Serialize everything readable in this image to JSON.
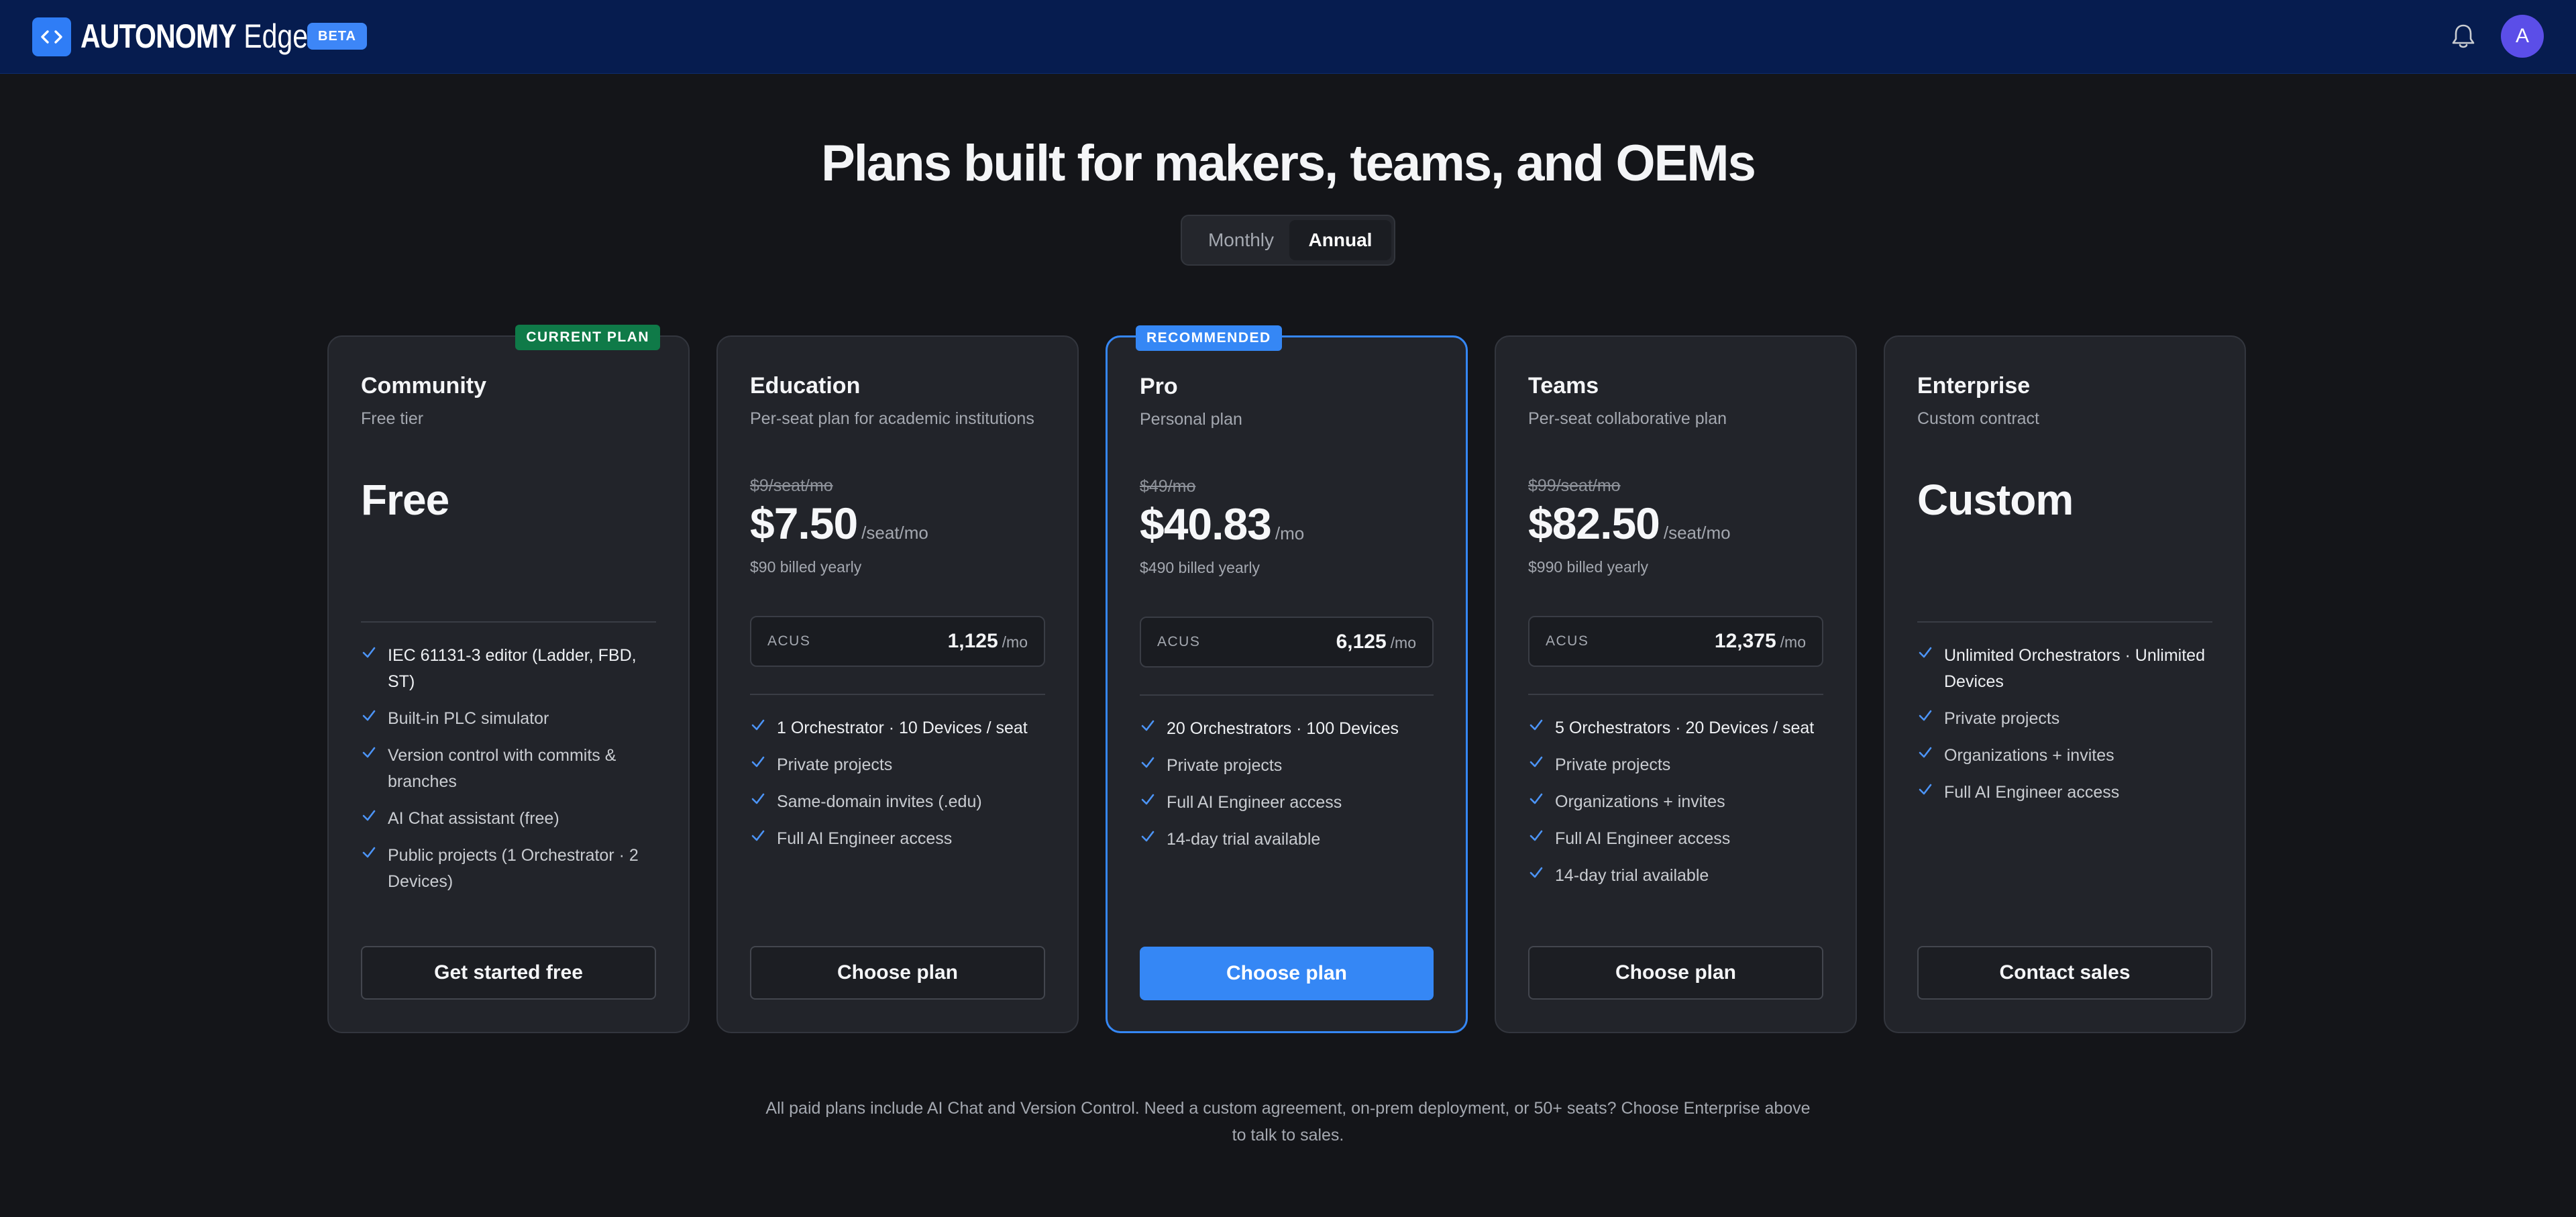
{
  "app": {
    "brand_bold": "AUTONOMY",
    "brand_light": "Edge",
    "beta_badge": "BETA",
    "avatar_initial": "A",
    "icons": [
      "code-brackets-icon",
      "bell-icon"
    ],
    "accent_color": "#3587f5"
  },
  "page": {
    "title": "Plans built for makers, teams, and OEMs",
    "billing_toggle": {
      "monthly": "Monthly",
      "annual": "Annual",
      "selected": "Annual"
    }
  },
  "plans": [
    {
      "name": "Community",
      "subtitle": "Free tier",
      "badge": "CURRENT PLAN",
      "price": "Free",
      "features": [
        "IEC 61131-3 editor (Ladder, FBD, ST)",
        "Built-in PLC simulator",
        "Version control with commits & branches",
        "AI Chat assistant (free)",
        "Public projects (1 Orchestrator · 2 Devices)"
      ],
      "cta": "Get started free"
    },
    {
      "name": "Education",
      "subtitle": "Per-seat plan for academic institutions",
      "old_price": "$9/seat/mo",
      "price": "$7.50",
      "price_unit": "/seat/mo",
      "billed": "$90 billed yearly",
      "acus_label": "ACUS",
      "acus_value": "1,125",
      "acus_unit": "/mo",
      "features": [
        "1 Orchestrator · 10 Devices / seat",
        "Private projects",
        "Same-domain invites (.edu)",
        "Full AI Engineer access"
      ],
      "cta": "Choose plan"
    },
    {
      "name": "Pro",
      "subtitle": "Personal plan",
      "badge": "RECOMMENDED",
      "old_price": "$49/mo",
      "price": "$40.83",
      "price_unit": "/mo",
      "billed": "$490 billed yearly",
      "acus_label": "ACUS",
      "acus_value": "6,125",
      "acus_unit": "/mo",
      "features": [
        "20 Orchestrators · 100 Devices",
        "Private projects",
        "Full AI Engineer access",
        "14-day trial available"
      ],
      "cta": "Choose plan"
    },
    {
      "name": "Teams",
      "subtitle": "Per-seat collaborative plan",
      "old_price": "$99/seat/mo",
      "price": "$82.50",
      "price_unit": "/seat/mo",
      "billed": "$990 billed yearly",
      "acus_label": "ACUS",
      "acus_value": "12,375",
      "acus_unit": "/mo",
      "features": [
        "5 Orchestrators · 20 Devices / seat",
        "Private projects",
        "Organizations + invites",
        "Full AI Engineer access",
        "14-day trial available"
      ],
      "cta": "Choose plan"
    },
    {
      "name": "Enterprise",
      "subtitle": "Custom contract",
      "price": "Custom",
      "features": [
        "Unlimited Orchestrators · Unlimited Devices",
        "Private projects",
        "Organizations + invites",
        "Full AI Engineer access"
      ],
      "cta": "Contact sales"
    }
  ],
  "footnote": "All paid plans include AI Chat and Version Control. Need a custom agreement, on-prem deployment, or 50+ seats? Choose Enterprise above to talk to sales."
}
